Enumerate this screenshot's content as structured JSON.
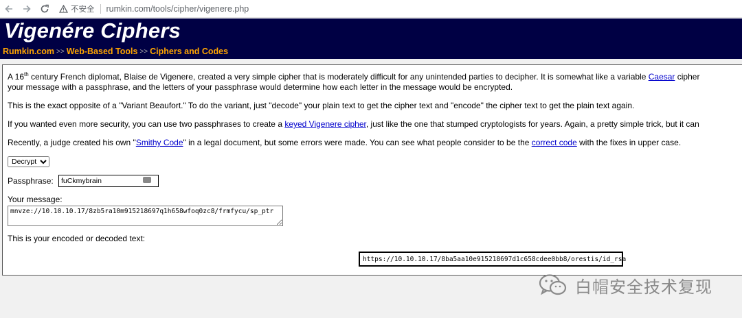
{
  "browser": {
    "security_label": "不安全",
    "url": "rumkin.com/tools/cipher/vigenere.php"
  },
  "header": {
    "title": "Vigenére Ciphers",
    "crumbs": [
      "Rumkin.com",
      "Web-Based Tools",
      "Ciphers and Codes"
    ],
    "crumb_separator": ">>"
  },
  "content": {
    "p1": {
      "a": "A 16",
      "sup": "th",
      "b": " century French diplomat, Blaise de Vigenere, created a very simple cipher that is moderately difficult for any unintended parties to decipher. It is somewhat like a variable ",
      "link": "Caesar",
      "c": " cipher",
      "line2": "your message with a passphrase, and the letters of your passphrase would determine how each letter in the message would be encrypted."
    },
    "p2": "This is the exact opposite of a \"Variant Beaufort.\" To do the variant, just \"decode\" your plain text to get the cipher text and \"encode\" the cipher text to get the plain text again.",
    "p3": {
      "a": "If you wanted even more security, you can use two passphrases to create a ",
      "link": "keyed Vigenere cipher",
      "b": ", just like the one that stumped cryptologists for years. Again, a pretty simple trick, but it can"
    },
    "p4": {
      "a": "Recently, a judge created his own \"",
      "link1": "Smithy Code",
      "b": "\" in a legal document, but some errors were made. You can see what people consider to be the ",
      "link2": "correct code",
      "c": " with the fixes in upper case."
    },
    "mode_selected": "Decrypt",
    "passphrase_label": "Passphrase:",
    "passphrase_value": "fuCkmybrain",
    "message_label": "Your message:",
    "message_value": "mnvze://10.10.10.17/8zb5ra10m915218697q1h658wfoq0zc8/frmfycu/sp_ptr",
    "result_label": "This is your encoded or decoded text:",
    "result_value": "https://10.10.10.17/8ba5aa10e915218697d1c658cdee0bb8/orestis/id_rsa"
  },
  "watermark": {
    "text": "白帽安全技术复现"
  }
}
